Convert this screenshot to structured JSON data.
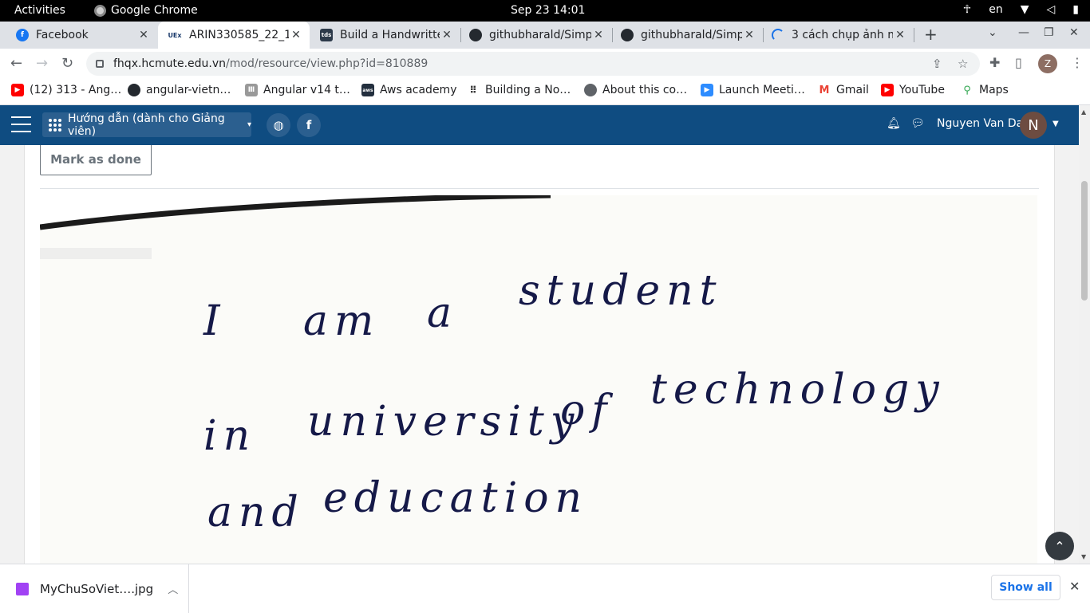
{
  "os_topbar": {
    "activities": "Activities",
    "app_name": "Google Chrome",
    "clock": "Sep 23  14:01",
    "keyboard_layout": "en"
  },
  "tabs": [
    {
      "title": "Facebook",
      "favicon_color": "#1877f2",
      "favicon_text": "f",
      "active": false
    },
    {
      "title": "ARIN330585_22_1_",
      "favicon_color": "#1a3a6b",
      "favicon_text": "UEx",
      "active": true
    },
    {
      "title": "Build a Handwritte",
      "favicon_color": "#2d3a4a",
      "favicon_text": "tds",
      "active": false
    },
    {
      "title": "githubharald/Simp",
      "favicon_color": "#24292f",
      "favicon_text": "gh",
      "active": false
    },
    {
      "title": "githubharald/Simp",
      "favicon_color": "#24292f",
      "favicon_text": "gh",
      "active": false
    },
    {
      "title": "3 cách chụp ảnh m",
      "favicon_color": "#1a73e8",
      "favicon_text": "",
      "active": false
    }
  ],
  "toolbar": {
    "url_host": "fhqx.hcmute.edu.vn",
    "url_path": "/mod/resource/view.php?id=810889",
    "profile_initial": "Z"
  },
  "bookmarks": [
    {
      "label": "(12) 313 - Ang…",
      "icon": "youtube-icon",
      "color": "#ff0000"
    },
    {
      "label": "angular-vietn…",
      "icon": "github-icon",
      "color": "#24292f"
    },
    {
      "label": "Angular v14 t…",
      "icon": "angular-icon",
      "color": "#999999"
    },
    {
      "label": "Aws academy",
      "icon": "aws-icon",
      "color": "#232f3e"
    },
    {
      "label": "Building a No…",
      "icon": "grid-icon",
      "color": "#333333"
    },
    {
      "label": "About this co…",
      "icon": "globe-icon",
      "color": "#5f6368"
    },
    {
      "label": "Launch Meeti…",
      "icon": "zoom-icon",
      "color": "#2d8cff"
    },
    {
      "label": "Gmail",
      "icon": "gmail-icon",
      "color": "#ea4335"
    },
    {
      "label": "YouTube",
      "icon": "youtube-icon",
      "color": "#ff0000"
    },
    {
      "label": "Maps",
      "icon": "maps-icon",
      "color": "#34a853"
    }
  ],
  "moodle": {
    "course_menu": "Hướng dẫn (dành cho Giảng viên)",
    "user_name": "Nguyen Van Dat",
    "user_initial": "N"
  },
  "page": {
    "mark_as_done": "Mark as done",
    "handwriting": {
      "line1_words": [
        "I",
        "am",
        "a",
        "student"
      ],
      "line2_words": [
        "in",
        "university",
        "of",
        "technology"
      ],
      "line3_words": [
        "and",
        "education"
      ]
    }
  },
  "downloads": {
    "file_name": "MyChuSoViet….jpg",
    "show_all": "Show all"
  }
}
